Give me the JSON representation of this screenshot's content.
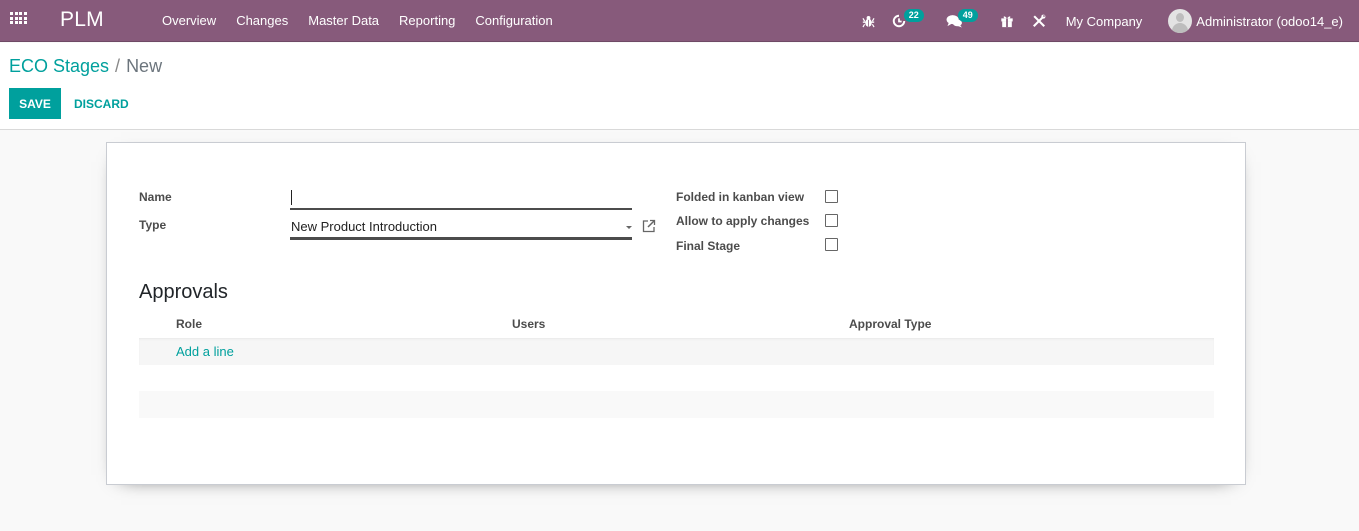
{
  "navbar": {
    "brand": "PLM",
    "menu": [
      "Overview",
      "Changes",
      "Master Data",
      "Reporting",
      "Configuration"
    ],
    "icons": {
      "apps": "apps-grid-icon",
      "debug": "bug-icon",
      "activities": "clock-icon",
      "messages": "comments-icon",
      "gift": "gift-icon",
      "tools": "tools-icon"
    },
    "activities_count": "22",
    "messages_count": "49",
    "company": "My Company",
    "user": "Administrator (odoo14_e)"
  },
  "control_panel": {
    "breadcrumb_parent": "ECO Stages",
    "breadcrumb_separator": "/",
    "breadcrumb_current": "New",
    "save_label": "SAVE",
    "discard_label": "DISCARD"
  },
  "form": {
    "name_label": "Name",
    "name_value": "",
    "type_label": "Type",
    "type_value": "New Product Introduction",
    "checkboxes": [
      {
        "label": "Folded in kanban view",
        "checked": false
      },
      {
        "label": "Allow to apply changes",
        "checked": false
      },
      {
        "label": "Final Stage",
        "checked": false
      }
    ],
    "approvals": {
      "title": "Approvals",
      "columns": [
        "Role",
        "Users",
        "Approval Type"
      ],
      "add_line": "Add a line"
    }
  },
  "colors": {
    "navbar": "#875a7b",
    "accent": "#00a09d",
    "badge": "#00a09d"
  }
}
